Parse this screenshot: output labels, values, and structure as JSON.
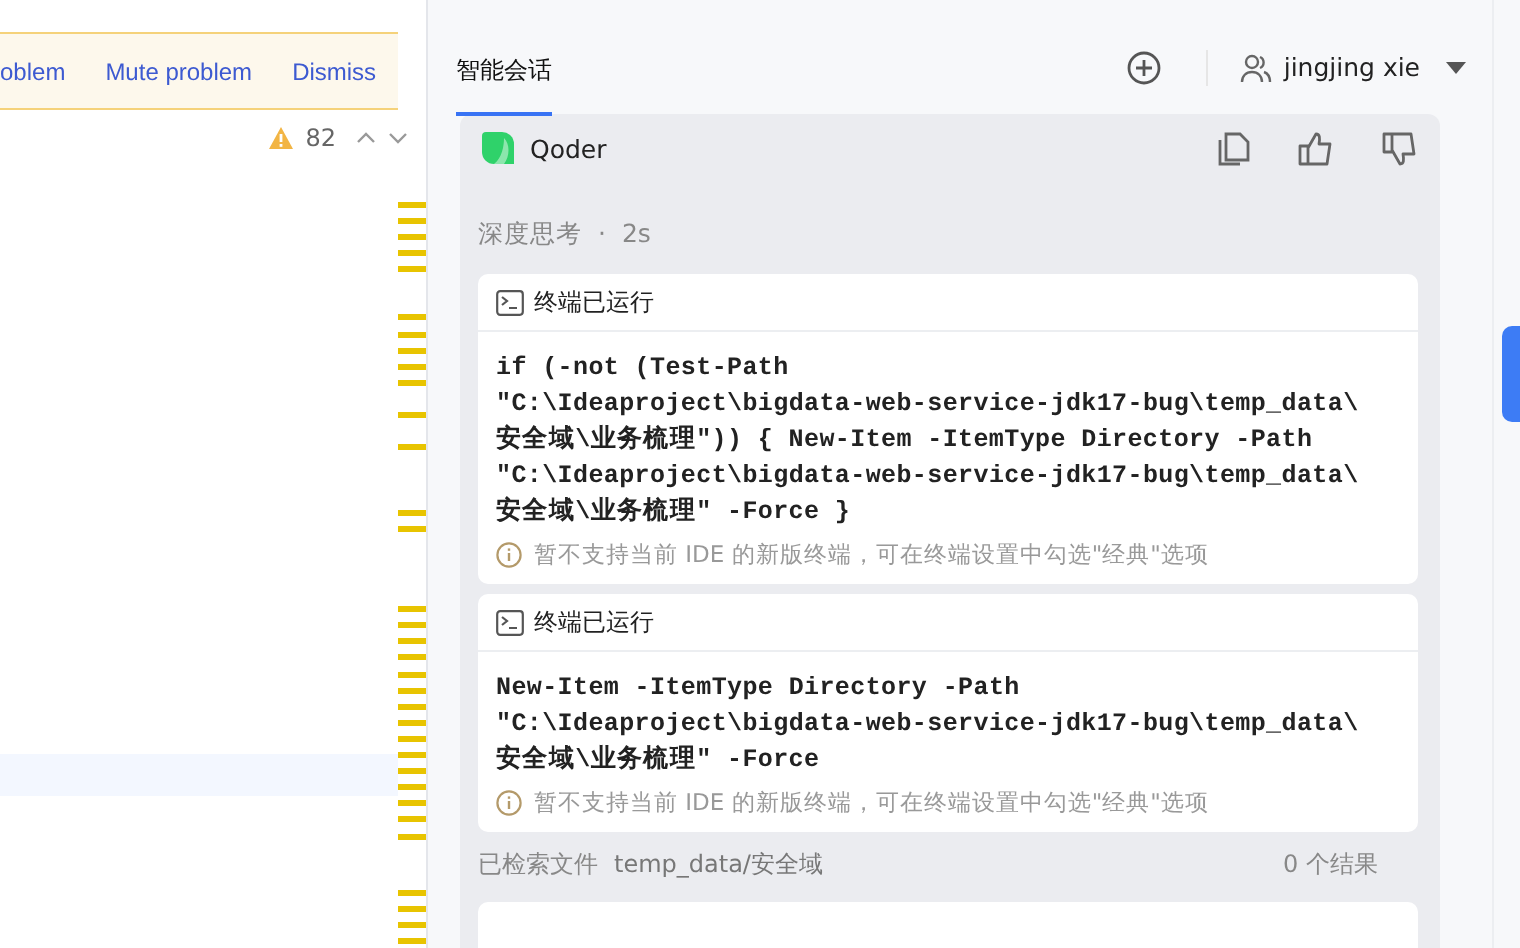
{
  "editor": {
    "banner": {
      "actions": [
        "oblem",
        "Mute problem",
        "Dismiss"
      ]
    },
    "inspections": {
      "warning_count": "82"
    }
  },
  "assistant": {
    "tabs": [
      {
        "label": "智能会话",
        "selected": true
      }
    ],
    "user": {
      "name": "jingjing xie"
    },
    "message": {
      "author": "Qoder",
      "thinking": {
        "label": "深度思考",
        "separator": "·",
        "duration": "2s"
      },
      "terminal_cards": [
        {
          "title": "终端已运行",
          "command_lines": [
            "if (-not (Test-Path",
            "\"C:\\Ideaproject\\bigdata-web-service-jdk17-bug\\temp_data\\",
            "安全域\\业务梳理\")) { New-Item -ItemType Directory -Path",
            "\"C:\\Ideaproject\\bigdata-web-service-jdk17-bug\\temp_data\\",
            "安全域\\业务梳理\" -Force }"
          ],
          "note": "暂不支持当前 IDE 的新版终端，可在终端设置中勾选\"经典\"选项"
        },
        {
          "title": "终端已运行",
          "command_lines": [
            "New-Item -ItemType Directory -Path",
            "\"C:\\Ideaproject\\bigdata-web-service-jdk17-bug\\temp_data\\",
            "安全域\\业务梳理\" -Force"
          ],
          "note": "暂不支持当前 IDE 的新版终端，可在终端设置中勾选\"经典\"选项"
        }
      ],
      "search": {
        "label": "已检索文件",
        "path": "temp_data/安全域",
        "result": "0 个结果"
      }
    }
  }
}
